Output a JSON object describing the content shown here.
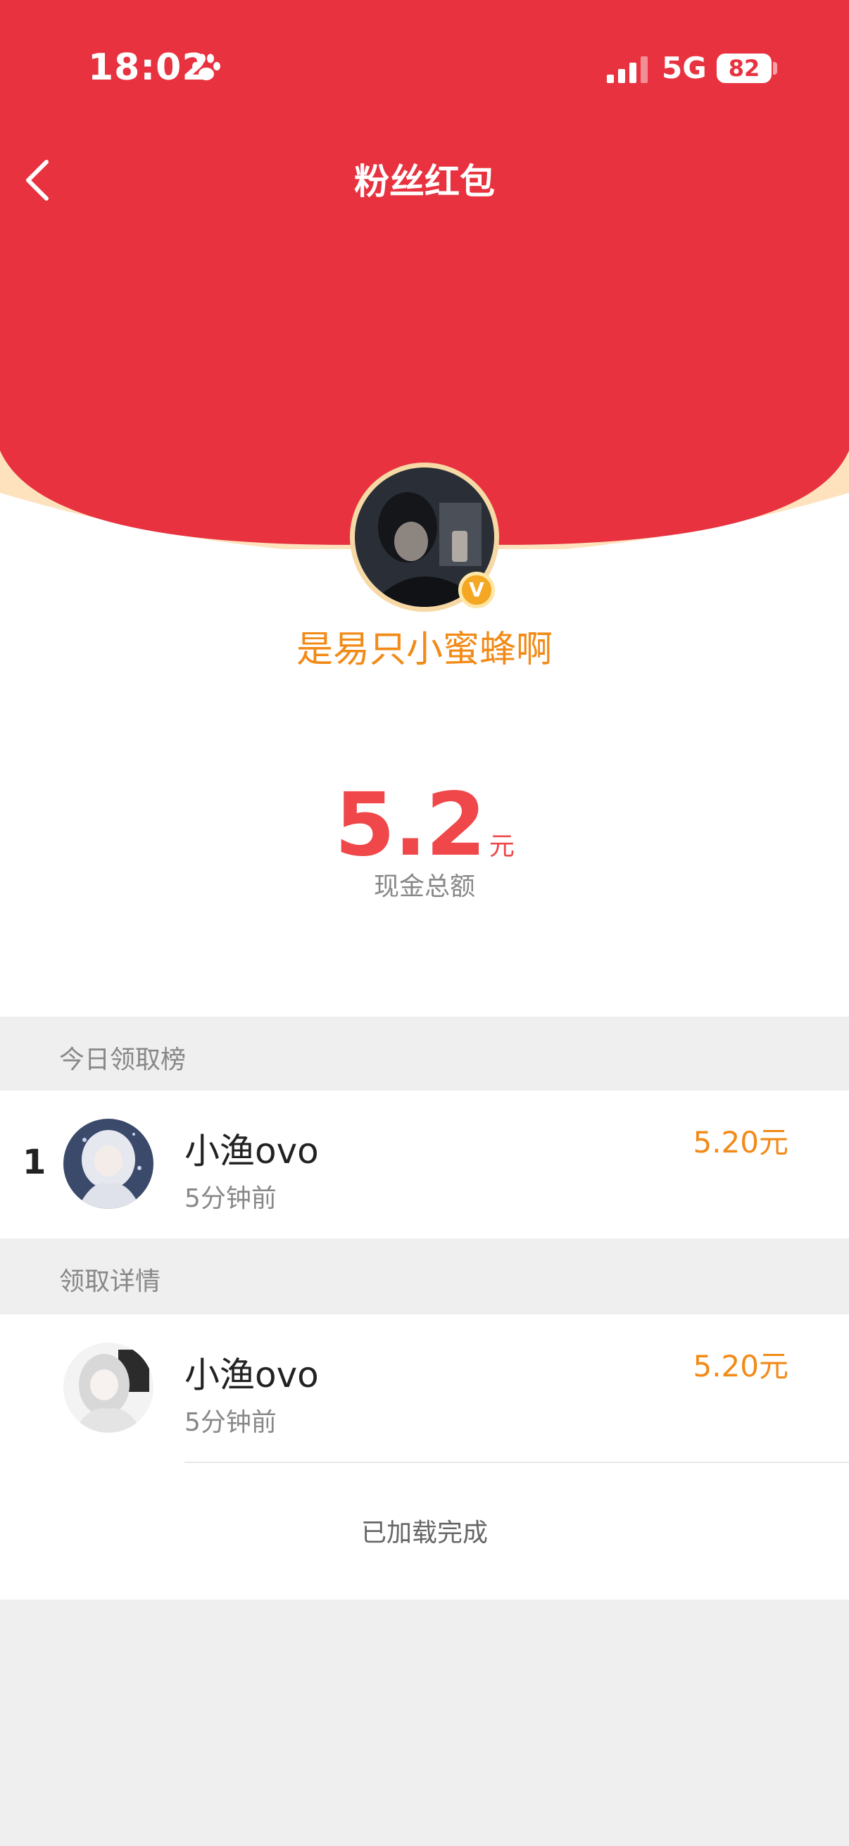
{
  "status_bar": {
    "time": "18:02",
    "network": "5G",
    "battery": "82",
    "icons": [
      "paw-icon",
      "signal-icon"
    ]
  },
  "header": {
    "title": "粉丝红包",
    "back_icon": "chevron-left-icon"
  },
  "colors": {
    "header_red": "#e8323f",
    "accent_orange": "#f28a17",
    "amount_red": "#f0474a"
  },
  "sender": {
    "name": "是易只小蜜蜂啊",
    "verified_badge": "V"
  },
  "amount": {
    "value": "5.2",
    "unit": "元",
    "caption": "现金总额"
  },
  "sections": {
    "today_rank": {
      "title": "今日领取榜",
      "items": [
        {
          "rank": "1",
          "name": "小渔ovo",
          "time": "5分钟前",
          "amount": "5.20元"
        }
      ]
    },
    "details": {
      "title": "领取详情",
      "items": [
        {
          "name": "小渔ovo",
          "time": "5分钟前",
          "amount": "5.20元"
        }
      ]
    }
  },
  "footer": {
    "text": "已加载完成"
  }
}
